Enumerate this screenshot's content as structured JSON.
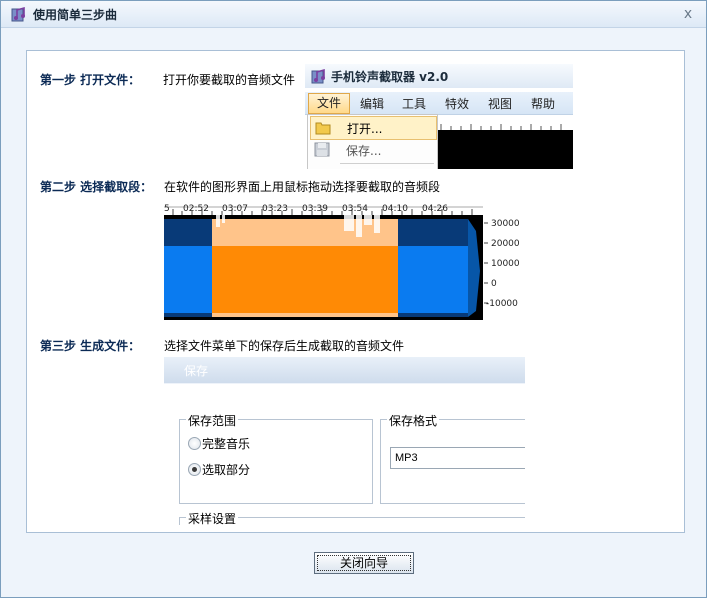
{
  "window": {
    "title": "使用简单三步曲",
    "close_glyph": "x"
  },
  "steps": [
    {
      "label": "第一步  打开文件：",
      "desc": "打开你要截取的音频文件"
    },
    {
      "label": "第二步  选择截取段：",
      "desc": "在软件的图形界面上用鼠标拖动选择要截取的音频段"
    },
    {
      "label": "第三步  生成文件：",
      "desc": "选择文件菜单下的保存后生成截取的音频文件"
    }
  ],
  "app_preview": {
    "title": "手机铃声截取器 v2.0",
    "menu": [
      "文件",
      "编辑",
      "工具",
      "特效",
      "视图",
      "帮助"
    ],
    "active_menu": 0,
    "dropdown": [
      {
        "label": "打开...",
        "icon": "folder-icon",
        "highlighted": true
      },
      {
        "label": "保存...",
        "icon": "floppy-disk-icon",
        "highlighted": false
      }
    ]
  },
  "waveform": {
    "time_ticks": [
      "02:52",
      "03:07",
      "03:23",
      "03:39",
      "03:54",
      "04:10",
      "04:26"
    ],
    "amplitude_ticks": [
      "30000",
      "20000",
      "10000",
      "0",
      "-10000"
    ],
    "colors": {
      "unselected": "#0a7bf0",
      "unselected_dark": "#083a78",
      "selected": "#ff8a05",
      "selected_light": "#ffc48a",
      "background": "#000000"
    }
  },
  "save_dialog": {
    "title": "保存",
    "range_group": "保存范围",
    "options": [
      {
        "label": "完整音乐",
        "selected": false
      },
      {
        "label": "选取部分",
        "selected": true
      }
    ],
    "format_group": "保存格式",
    "format_value": "MP3",
    "sampling_group": "采样设置"
  },
  "footer": {
    "close_label": "关闭向导"
  }
}
